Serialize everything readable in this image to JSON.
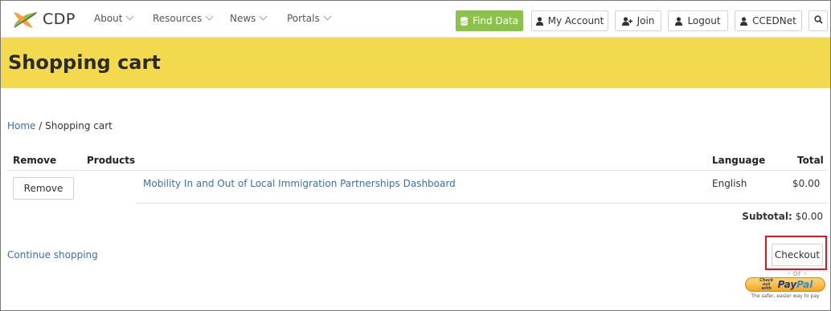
{
  "brand": {
    "name": "CDP"
  },
  "nav": {
    "menus": [
      "About",
      "Resources",
      "News",
      "Portals"
    ],
    "buttons": {
      "find_data": "Find Data",
      "my_account": "My Account",
      "join": "Join",
      "logout": "Logout",
      "ccednet": "CCEDNet"
    }
  },
  "page": {
    "title": "Shopping cart"
  },
  "breadcrumb": {
    "home": "Home",
    "separator": " / ",
    "current": "Shopping cart"
  },
  "cart": {
    "headers": {
      "remove": "Remove",
      "products": "Products",
      "language": "Language",
      "total": "Total"
    },
    "items": [
      {
        "remove_label": "Remove",
        "product": "Mobility In and Out of Local Immigration Partnerships Dashboard",
        "language": "English",
        "total": "$0.00"
      }
    ],
    "subtotal_label": "Subtotal:",
    "subtotal_value": "$0.00"
  },
  "actions": {
    "continue": "Continue shopping",
    "checkout": "Checkout",
    "or": "- or -",
    "paypal": {
      "small": "Check out with",
      "brand_a": "Pay",
      "brand_b": "Pal",
      "tagline": "The safer, easier way to pay"
    }
  },
  "colors": {
    "banner": "#f2d94e",
    "link": "#3a6fb0",
    "find_data": "#8bc34a",
    "highlight": "#e0141e"
  },
  "icons": [
    "cdp-leaf-logo",
    "chevron-down-icon",
    "database-icon",
    "user-icon",
    "user-plus-icon",
    "search-icon"
  ]
}
